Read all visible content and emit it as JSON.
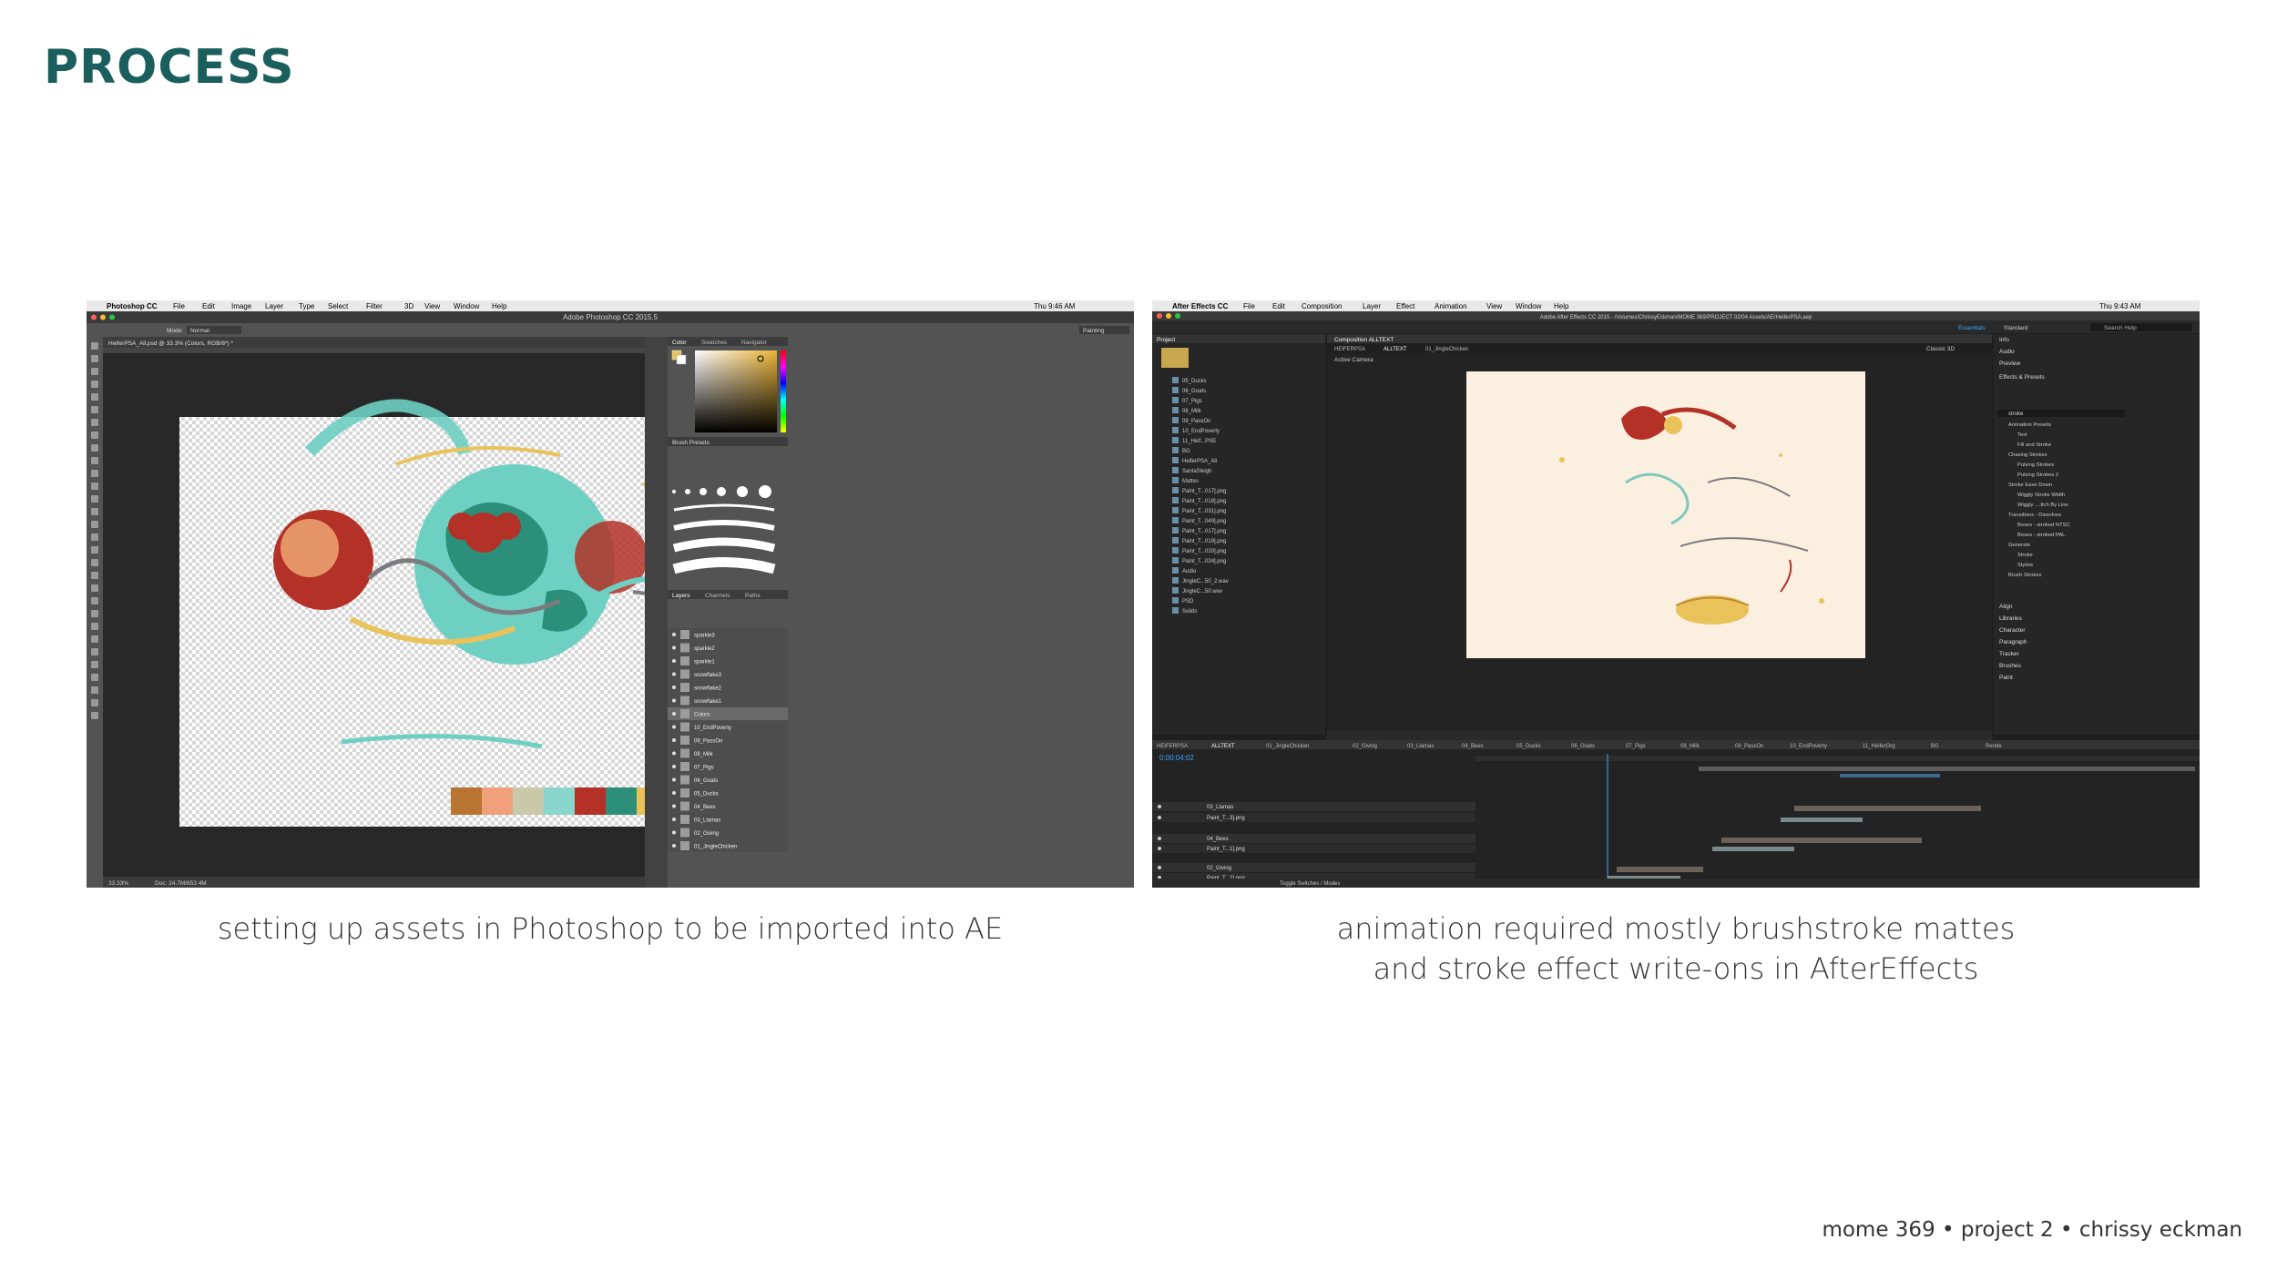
{
  "title": "PROCESS",
  "photoshop": {
    "app_name": "Photoshop CC",
    "menus": [
      "File",
      "Edit",
      "Image",
      "Layer",
      "Type",
      "Select",
      "Filter",
      "3D",
      "View",
      "Window",
      "Help"
    ],
    "clock": "Thu 9:46 AM",
    "window_title": "Adobe Photoshop CC 2015.5",
    "doc_tab": "HelferPSA_All.psd @ 33.3% (Colors, RGB/8*) *",
    "mode_label": "Normal",
    "workspace": "Painting",
    "zoom": "33.33%",
    "doc_info": "Doc: 24.7M/853.4M",
    "panel_tabs": [
      "Color",
      "Swatches",
      "Navigator"
    ],
    "brush_presets": "Brush Presets",
    "layers_tabs": [
      "Layers",
      "Channels",
      "Paths"
    ],
    "layers": [
      "sparkle3",
      "sparkle2",
      "sparkle1",
      "snowflake3",
      "snowflake2",
      "snowflake1",
      "Colors",
      "10_EndPoverty",
      "09_PassOn",
      "08_Milk",
      "07_Pigs",
      "06_Goats",
      "05_Ducks",
      "04_Bees",
      "03_Llamas",
      "02_Giving",
      "01_JingleChicken"
    ],
    "swatches": [
      "#b87430",
      "#f0a07a",
      "#c9c8a8",
      "#8ad6cc",
      "#b33127",
      "#2b8f7a",
      "#e9c35a",
      "#8a8a8e",
      "#2b4566"
    ]
  },
  "aftereffects": {
    "app_name": "After Effects CC",
    "menus": [
      "File",
      "Edit",
      "Composition",
      "Layer",
      "Effect",
      "Animation",
      "View",
      "Window",
      "Help"
    ],
    "clock": "Thu 9:43 AM",
    "window_title": "Adobe After Effects CC 2015 - /Volumes/ChrissyEckman/MOME 369/PROJECT 02/04 Assets/AE/HeiferPSA.aep",
    "workspaces": [
      "Essentials",
      "Standard"
    ],
    "search": "Search Help",
    "project_tab": "Project",
    "composition_tab": "Composition ALLTEXT",
    "comp_breadcrumb": [
      "HEIFERPSA",
      "ALLTEXT",
      "01_JingleChicken"
    ],
    "active_camera": "Active Camera",
    "renderer": "Classic 3D",
    "project_items": [
      "05_Ducks",
      "06_Goats",
      "07_Pigs",
      "08_Milk",
      "09_PassOn",
      "10_EndPoverty",
      "11_Heif...PSE",
      "BG",
      "HeiferPSA_All",
      "SantaSleigh",
      "Mattes",
      "Paint_T...017].png",
      "Paint_T...018].png",
      "Paint_T...031].png",
      "Paint_T...049].png",
      "Paint_T...017].png",
      "Paint_T...019].png",
      "Paint_T...020].png",
      "Paint_T...024].png",
      "Audio",
      "JingleC...50_2.wav",
      "JingleC...50.wav",
      "PSD",
      "Solids"
    ],
    "timecode": "0:00:04:02",
    "timeline_tabs": [
      "HEIFERPSA",
      "ALLTEXT",
      "01_JingleChicken",
      "02_Giving",
      "03_Llamas",
      "04_Bees",
      "05_Ducks",
      "06_Goats",
      "07_Pigs",
      "08_Milk",
      "09_PassOn",
      "10_EndPoverty",
      "11_HeiferOrg",
      "BG",
      "Rende"
    ],
    "right_panels": [
      "Info",
      "Audio",
      "Preview",
      "Effects & Presets",
      "Align",
      "Libraries",
      "Character",
      "Paragraph",
      "Tracker",
      "Brushes",
      "Paint"
    ],
    "effects_search": "stroke",
    "effects_tree": [
      "Animation Presets",
      "Text",
      "Fill and Stroke",
      "Chasing Strokes",
      "Pulsing Strokes",
      "Pulsing Strokes 2",
      "Stroke Ease Down",
      "Wiggly Stroke Width",
      "Wiggly ....ttch By Line",
      "Transitions - Dissolves",
      "Boxes - stroked NTSC",
      "Boxes - stroked PAL",
      "Generate",
      "Stroke",
      "Stylize",
      "Brush Strokes"
    ],
    "layers": [
      "03_Llamas",
      "Paint_T...3].png",
      "04_Bees",
      "Paint_T...1].png",
      "02_Giving",
      "Paint_T...2].png"
    ],
    "toggle": "Toggle Switches / Modes"
  },
  "captions": {
    "left": "setting up assets in Photoshop to be imported into AE",
    "right_line1": "animation required mostly brushstroke mattes",
    "right_line2": "and stroke effect write-ons in AfterEffects"
  },
  "footer": "mome 369 • project 2 • chrissy eckman"
}
